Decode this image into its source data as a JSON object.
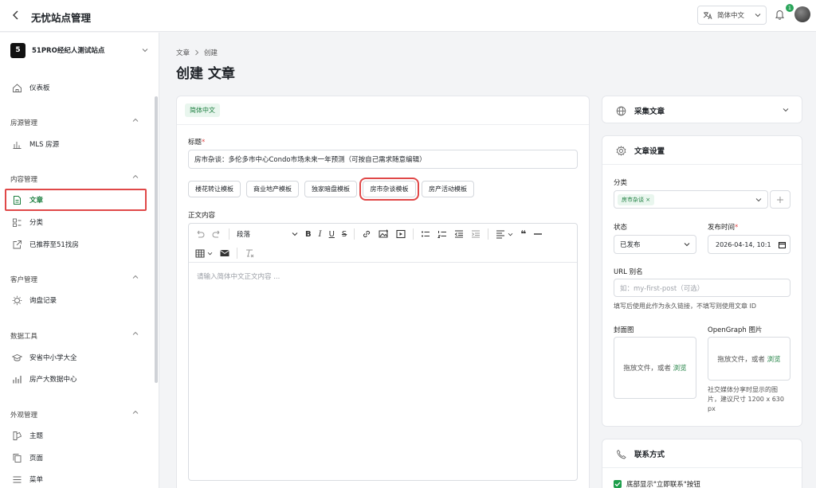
{
  "topbar": {
    "title": "无忧站点管理",
    "language": "简体中文",
    "notification_count": "1"
  },
  "sidebar": {
    "site_number": "5",
    "site_name": "51PRO经纪人测试站点",
    "dashboard": "仪表板",
    "sections": [
      {
        "title": "房源管理",
        "items": [
          "MLS 房源"
        ]
      },
      {
        "title": "内容管理",
        "items": [
          "文章",
          "分类",
          "已推荐至51找房"
        ]
      },
      {
        "title": "客户管理",
        "items": [
          "询盘记录"
        ]
      },
      {
        "title": "数据工具",
        "items": [
          "安省中小学大全",
          "房产大数据中心"
        ]
      },
      {
        "title": "外观管理",
        "items": [
          "主题",
          "页面",
          "菜单"
        ]
      }
    ]
  },
  "breadcrumb": {
    "parent": "文章",
    "current": "创建"
  },
  "page_title": "创建 文章",
  "editor_card": {
    "lang_tag": "简体中文",
    "title_label": "标题",
    "title_value": "房市杂谈：多伦多市中心Condo市场未来一年预测（可按自己需求随意编辑）",
    "templates": [
      "楼花转让模板",
      "商业地产模板",
      "独家暗盘模板",
      "房市杂谈模板",
      "房产活动模板"
    ],
    "content_label": "正文内容",
    "paragraph_select": "段落",
    "placeholder": "请输入简体中文正文内容 ..."
  },
  "collect_card": {
    "title": "采集文章"
  },
  "settings_card": {
    "title": "文章设置",
    "category_label": "分类",
    "category_tag": "房市杂谈 ×",
    "status_label": "状态",
    "status_value": "已发布",
    "publish_label": "发布时间",
    "publish_value": "2026-04-14, 10:1",
    "url_label": "URL 别名",
    "url_placeholder": "如：my-first-post（可选）",
    "url_hint": "填写后使用此作为永久链接，不填写则使用文章 ID",
    "cover_label": "封面图",
    "og_label": "OpenGraph 图片",
    "drop_text": "拖放文件，或者",
    "drop_link": "浏览",
    "og_hint_1": "社交媒体分享时显示的图",
    "og_hint_2": "片，建议尺寸 1200 x 630",
    "og_hint_3": "px"
  },
  "contact_card": {
    "title": "联系方式",
    "checkbox_label": "底部显示\"立即联系\"按钮"
  },
  "colors": {
    "accent": "#1d7f40",
    "highlight": "#e04848"
  }
}
